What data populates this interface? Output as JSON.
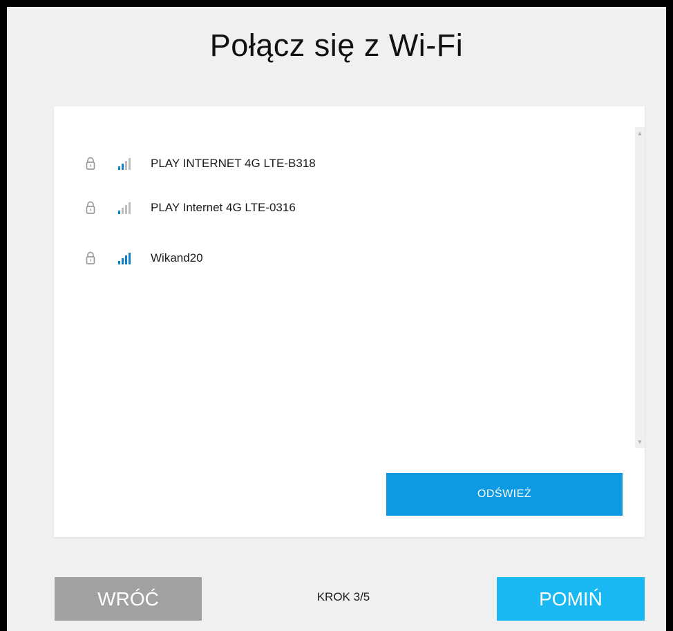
{
  "page": {
    "title": "Połącz się z Wi-Fi"
  },
  "networks": [
    {
      "ssid": "PLAY INTERNET 4G LTE-B318",
      "secured": true,
      "signal_bars": 2,
      "lock_icon": "lock-icon",
      "signal_icon": "wifi-signal-icon"
    },
    {
      "ssid": "PLAY Internet 4G LTE-0316",
      "secured": true,
      "signal_bars": 1,
      "lock_icon": "lock-icon",
      "signal_icon": "wifi-signal-icon"
    },
    {
      "ssid": "Wikand20",
      "secured": true,
      "signal_bars": 4,
      "lock_icon": "lock-icon",
      "signal_icon": "wifi-signal-icon"
    }
  ],
  "actions": {
    "refresh_label": "ODŚWIEŻ",
    "back_label": "WRÓĆ",
    "skip_label": "POMIŃ",
    "step_label": "KROK 3/5"
  },
  "colors": {
    "background": "#f0f0f0",
    "card": "#ffffff",
    "refresh_button": "#0d9ae3",
    "skip_button": "#19b8f2",
    "back_button": "#a1a1a1",
    "signal_active": "#0d7fcb",
    "signal_inactive": "#bdbdbd",
    "lock": "#9a9a9a"
  },
  "icons": {
    "lock": "lock-icon",
    "signal": "wifi-signal-icon",
    "scroll_up": "chevron-up-icon",
    "scroll_down": "chevron-down-icon"
  }
}
